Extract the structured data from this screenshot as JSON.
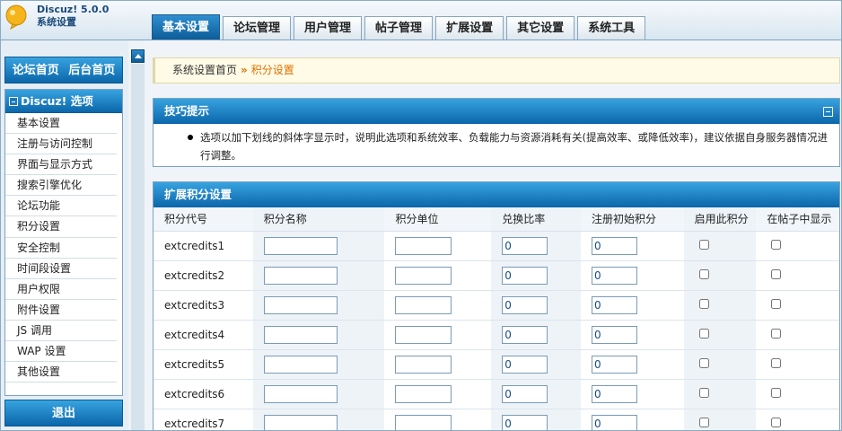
{
  "app": {
    "name": "Discuz! 5.0.0",
    "subtitle": "系统设置"
  },
  "tabs": [
    {
      "label": "基本设置",
      "active": true
    },
    {
      "label": "论坛管理",
      "active": false
    },
    {
      "label": "用户管理",
      "active": false
    },
    {
      "label": "帖子管理",
      "active": false
    },
    {
      "label": "扩展设置",
      "active": false
    },
    {
      "label": "其它设置",
      "active": false
    },
    {
      "label": "系统工具",
      "active": false
    }
  ],
  "sidebar": {
    "top_links": [
      "论坛首页",
      "后台首页"
    ],
    "menu_title": "Discuz! 选项",
    "items": [
      "基本设置",
      "注册与访问控制",
      "界面与显示方式",
      "搜索引擎优化",
      "论坛功能",
      "积分设置",
      "安全控制",
      "时间段设置",
      "用户权限",
      "附件设置",
      "JS 调用",
      "WAP 设置",
      "其他设置"
    ],
    "logout": "退出"
  },
  "breadcrumb": {
    "home": "系统设置首页",
    "sep": "»",
    "current": "积分设置"
  },
  "tips": {
    "title": "技巧提示",
    "text": "选项以加下划线的斜体字显示时，说明此选项和系统效率、负载能力与资源消耗有关(提高效率、或降低效率)，建议依据自身服务器情况进行调整。"
  },
  "credits": {
    "title": "扩展积分设置",
    "columns": [
      "积分代号",
      "积分名称",
      "积分单位",
      "兑换比率",
      "注册初始积分",
      "启用此积分",
      "在帖子中显示"
    ],
    "rows": [
      {
        "code": "extcredits1",
        "name": "",
        "unit": "",
        "ratio": "0",
        "initial": "0"
      },
      {
        "code": "extcredits2",
        "name": "",
        "unit": "",
        "ratio": "0",
        "initial": "0"
      },
      {
        "code": "extcredits3",
        "name": "",
        "unit": "",
        "ratio": "0",
        "initial": "0"
      },
      {
        "code": "extcredits4",
        "name": "",
        "unit": "",
        "ratio": "0",
        "initial": "0"
      },
      {
        "code": "extcredits5",
        "name": "",
        "unit": "",
        "ratio": "0",
        "initial": "0"
      },
      {
        "code": "extcredits6",
        "name": "",
        "unit": "",
        "ratio": "0",
        "initial": "0"
      },
      {
        "code": "extcredits7",
        "name": "",
        "unit": "",
        "ratio": "0",
        "initial": "0"
      }
    ]
  },
  "colors": {
    "accent": "#0b66aa",
    "breadcrumb_current": "#e07000"
  }
}
